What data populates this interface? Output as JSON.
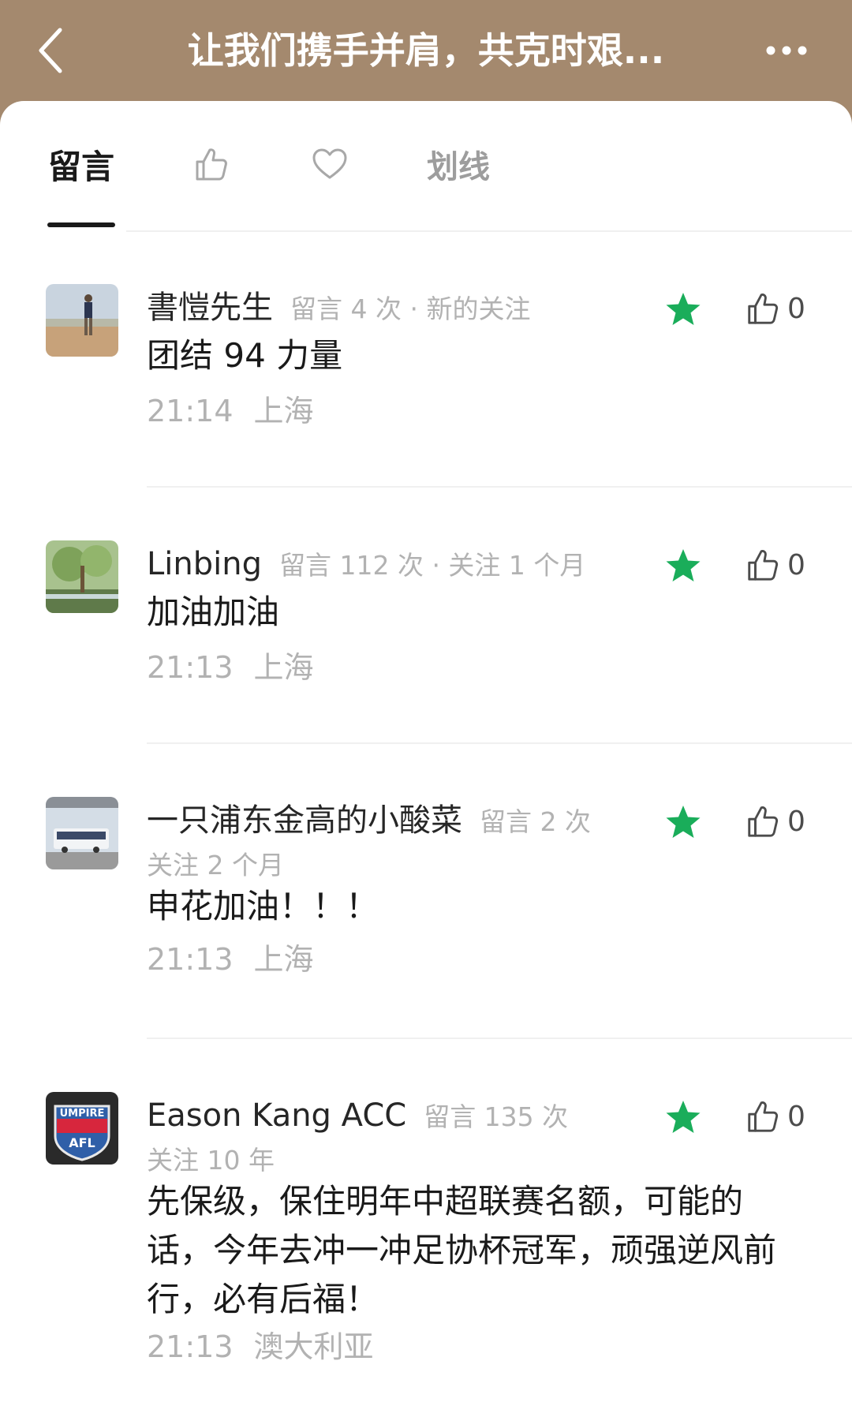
{
  "header": {
    "title": "让我们携手并肩，共克时艰...",
    "back_icon": "chevron-left-icon",
    "more_icon": "more-dots-icon"
  },
  "tabs": [
    {
      "label": "留言",
      "active": true
    },
    {
      "icon": "thumbs-up-icon"
    },
    {
      "icon": "heart-icon"
    },
    {
      "label": "划线"
    }
  ],
  "comments": [
    {
      "name": "書愷先生",
      "meta": "留言 4 次 · 新的关注",
      "meta2": "",
      "text": "团结 94 力量",
      "time": "21:14",
      "location": "上海",
      "likes": "0",
      "starred": true
    },
    {
      "name": "Linbing",
      "meta": "留言 112 次 · 关注 1 个月",
      "meta2": "",
      "text": "加油加油",
      "time": "21:13",
      "location": "上海",
      "likes": "0",
      "starred": true
    },
    {
      "name": "一只浦东金高的小酸菜",
      "meta": "留言 2 次",
      "meta2": "关注 2 个月",
      "text": "申花加油！！！",
      "time": "21:13",
      "location": "上海",
      "likes": "0",
      "starred": true
    },
    {
      "name": "Eason Kang ACC",
      "meta": "留言 135 次",
      "meta2": "关注 10 年",
      "text": "先保级，保住明年中超联赛名额，可能的话，今年去冲一冲足协杯冠军，顽强逆风前行，必有后福！",
      "time": "21:13",
      "location": "澳大利亚",
      "likes": "0",
      "starred": true,
      "avatar_text_top": "UMPIRE",
      "avatar_text_bottom": "AFL"
    }
  ],
  "colors": {
    "header_bg": "#a4896e",
    "star": "#1aad5a",
    "muted_text": "#b2b2b2"
  }
}
